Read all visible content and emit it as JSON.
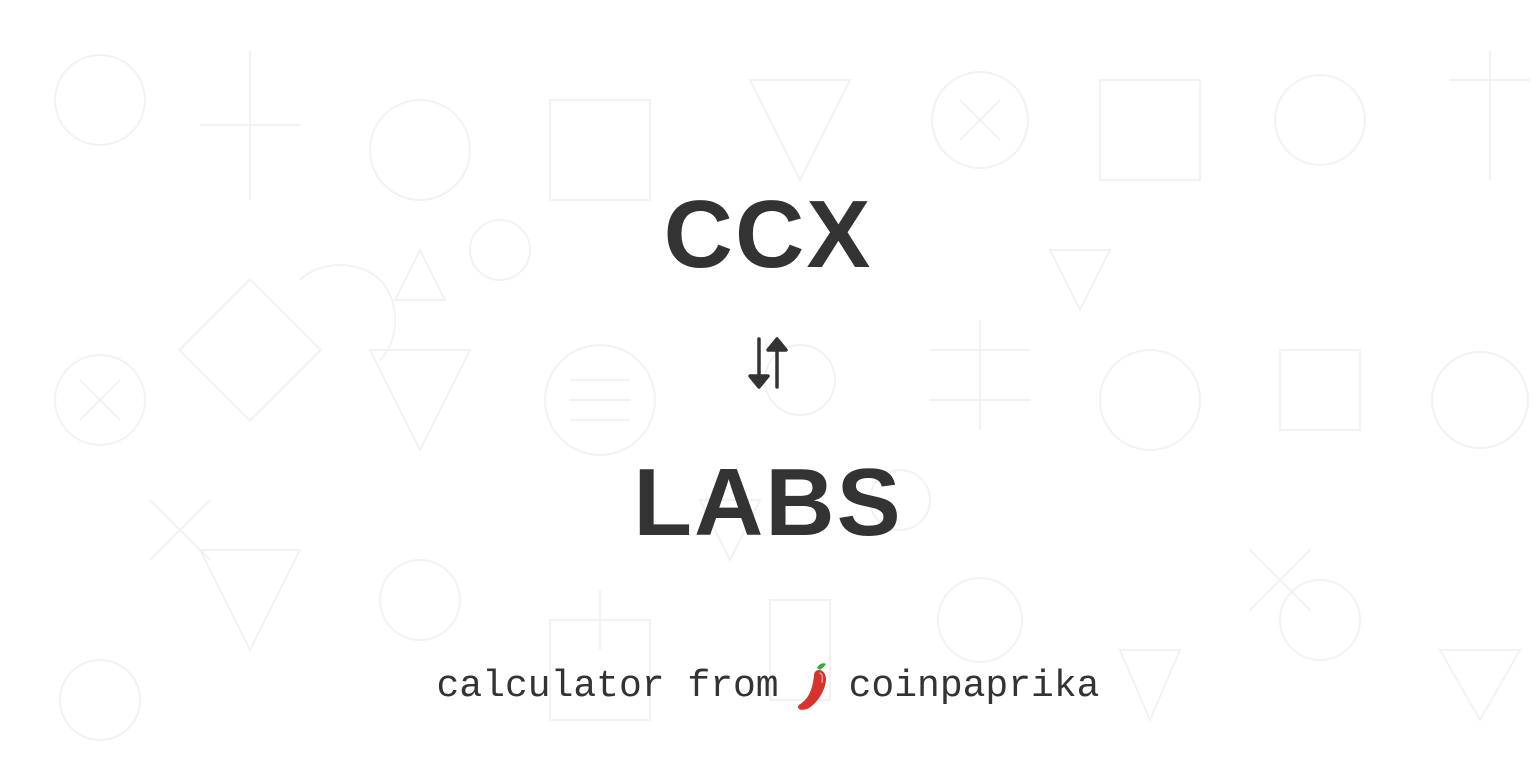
{
  "coin_from": "CCX",
  "coin_to": "LABS",
  "footer": {
    "prefix": "calculator from",
    "brand": "coinpaprika"
  },
  "colors": {
    "text": "#333333",
    "chili_red": "#d6332e",
    "chili_green": "#3aa83a",
    "background": "#ffffff"
  }
}
